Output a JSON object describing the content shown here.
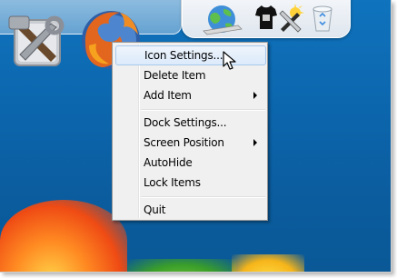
{
  "context_menu": {
    "items": [
      {
        "label": "Icon Settings...",
        "highlighted": true,
        "submenu": false
      },
      {
        "label": "Delete Item",
        "highlighted": false,
        "submenu": false
      },
      {
        "label": "Add Item",
        "highlighted": false,
        "submenu": true
      },
      {
        "label": "Dock Settings...",
        "highlighted": false,
        "submenu": false
      },
      {
        "label": "Screen Position",
        "highlighted": false,
        "submenu": true
      },
      {
        "label": "AutoHide",
        "highlighted": false,
        "submenu": false
      },
      {
        "label": "Lock Items",
        "highlighted": false,
        "submenu": false
      },
      {
        "label": "Quit",
        "highlighted": false,
        "submenu": false
      }
    ]
  },
  "dock": {
    "icons": [
      "tools-icon",
      "firefox-icon",
      "globe-icon",
      "tshirt-icon",
      "sunny-icon",
      "recycle-bin-icon"
    ]
  },
  "colors": {
    "desktop": "#0c66ad",
    "menu_background": "#f0f0f0",
    "highlight": "#dceafb",
    "highlight_border": "#a8c8ec"
  }
}
